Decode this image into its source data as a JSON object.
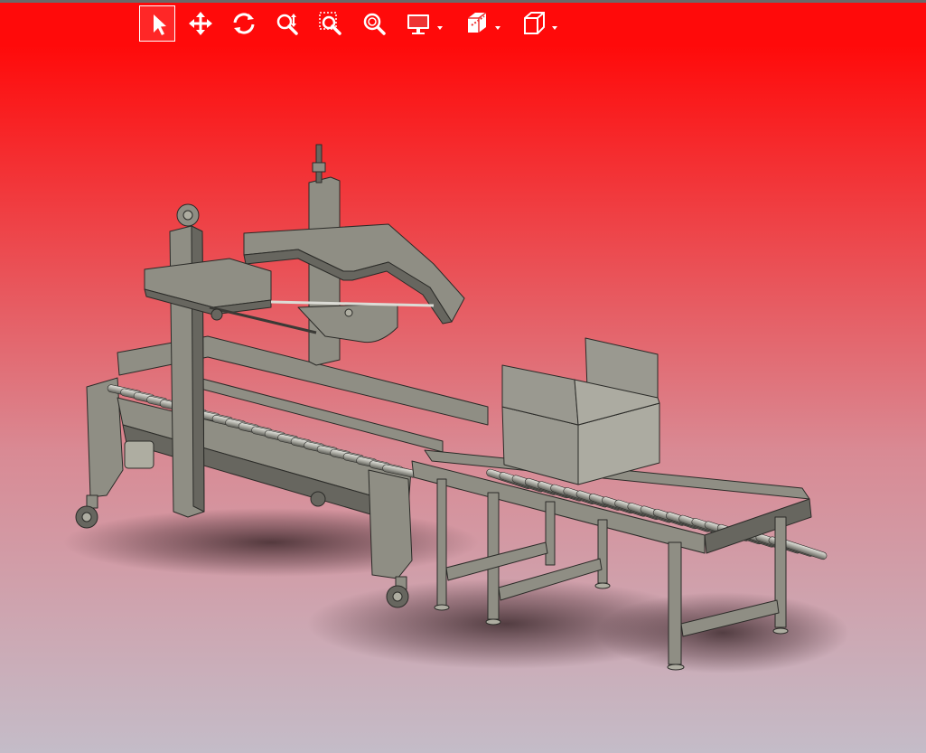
{
  "viewer": {
    "background": {
      "top_color": "#ff0a0a",
      "mid_color": "#d98a94",
      "bottom_color": "#c4bcc8"
    },
    "toolbar": {
      "active_tool": "select",
      "buttons": [
        {
          "id": "select",
          "icon": "cursor-arrow-icon"
        },
        {
          "id": "pan",
          "icon": "move-arrows-icon"
        },
        {
          "id": "rotate",
          "icon": "rotate-icon"
        },
        {
          "id": "zoom",
          "icon": "zoom-updown-icon"
        },
        {
          "id": "zoom-window",
          "icon": "zoom-window-icon"
        },
        {
          "id": "zoom-fit",
          "icon": "zoom-fit-icon"
        },
        {
          "id": "display-mode",
          "icon": "monitor-icon",
          "has_dropdown": true
        },
        {
          "id": "section-view",
          "icon": "section-box-icon",
          "has_dropdown": true
        },
        {
          "id": "standard-views",
          "icon": "cube-icon",
          "has_dropdown": true
        }
      ]
    },
    "model": {
      "part_color": "#8f8e84",
      "edge_color": "#2b2b28",
      "roller_color": "#b8b8b0",
      "box_color": "#9a9990"
    }
  }
}
